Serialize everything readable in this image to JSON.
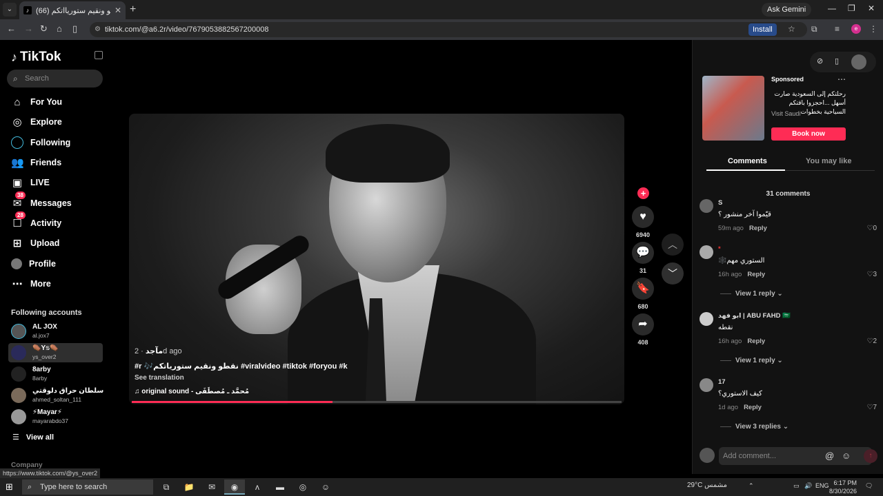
{
  "browser": {
    "tab_title": "(66) نقطو ونقيم ستوريااتكم 🎶#",
    "tab_close": "✕",
    "new_tab": "+",
    "ask_gemini": "Ask Gemini",
    "url": "tiktok.com/@a6.2r/video/7679053882567200008",
    "install": "Install",
    "profile_initial": "e",
    "status_url": "https://www.tiktok.com/@ys_over2"
  },
  "sidebar": {
    "logo": "TikTok",
    "search_placeholder": "Search",
    "nav": [
      {
        "label": "For You",
        "icon": "home-icon"
      },
      {
        "label": "Explore",
        "icon": "compass-icon"
      },
      {
        "label": "Following",
        "icon": "following-icon"
      },
      {
        "label": "Friends",
        "icon": "friends-icon"
      },
      {
        "label": "LIVE",
        "icon": "live-icon"
      },
      {
        "label": "Messages",
        "icon": "messages-icon",
        "badge": "38"
      },
      {
        "label": "Activity",
        "icon": "activity-icon",
        "badge": "28"
      },
      {
        "label": "Upload",
        "icon": "upload-icon"
      },
      {
        "label": "Profile",
        "icon": "avatar"
      },
      {
        "label": "More",
        "icon": "more-icon"
      }
    ],
    "following_title": "Following accounts",
    "accounts": [
      {
        "name": "AL JOX",
        "username": "al.jox7"
      },
      {
        "name": "⚰️Y𝕤⚰️",
        "username": "ys_over2"
      },
      {
        "name": "8arby",
        "username": "8arby"
      },
      {
        "name": "سلطان حراق دلوقتي",
        "username": "ahmed_soltan_111"
      },
      {
        "name": "⚡Mayar⚡",
        "username": "mayarabdo37"
      }
    ],
    "view_all": "View all",
    "company": "Company"
  },
  "video": {
    "author": "مآجد",
    "date": " · 2d ago",
    "caption": "#r 🎶نقطو ونقيم ستورياتكم #viralvideo #tiktok #foryou #k",
    "see_translation": "See translation",
    "sound": "original sound - مُحمَّد ـ مُصطَفَى",
    "progress": 0.41
  },
  "actions": {
    "likes": "6940",
    "comments": "31",
    "saves": "680",
    "shares": "408"
  },
  "ad": {
    "sponsored": "Sponsored",
    "text": "رحلتكم إلى السعودية صارت أسهل ...احجزوا باقتكم السياحية بخطوات",
    "link": "Visit Saudi",
    "cta": "Book now"
  },
  "panel": {
    "tab_comments": "Comments",
    "tab_may_like": "You may like",
    "comment_count": "31 comments",
    "comments": [
      {
        "name": "S",
        "text": "قيّموا آخر منشور ؟",
        "time": "59m ago",
        "reply": "Reply",
        "likes": "0"
      },
      {
        "name": "*",
        "text": "الستوري مهم🕸️",
        "time": "16h ago",
        "reply": "Reply",
        "likes": "3",
        "replies": "View 1 reply"
      },
      {
        "name": "ابو فهد | ABU FAHD 🇸🇦",
        "text": "نقطه",
        "time": "16h ago",
        "reply": "Reply",
        "likes": "2",
        "replies": "View 1 reply"
      },
      {
        "name": "17",
        "text": "كيف الاستوري؟",
        "time": "1d ago",
        "reply": "Reply",
        "likes": "7",
        "replies": "View 3 replies"
      }
    ],
    "add_comment_placeholder": "Add comment...",
    "mention_icon": "@",
    "emoji_icon": "☺"
  },
  "taskbar": {
    "search_placeholder": "Type here to search",
    "weather": "29°C  مشمس",
    "lang": "ENG",
    "time": "6:17 PM",
    "date": "8/30/2026"
  }
}
